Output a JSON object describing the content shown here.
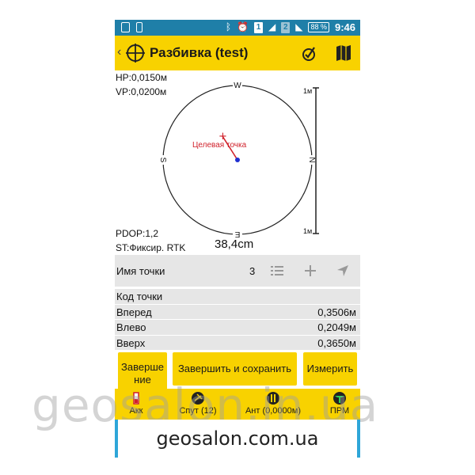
{
  "status_bar": {
    "battery": "88 %",
    "time": "9:46",
    "sim1": "1",
    "sim2": "2"
  },
  "toolbar": {
    "title": "Разбивка (test)",
    "icons": [
      "back-chevron-icon",
      "stakeout-target-icon",
      "stakeout-mode-icon",
      "map-icon"
    ]
  },
  "compass": {
    "hp": "HP:0,0150м",
    "vp": "VP:0,0200м",
    "pdop": "PDOP:1,2",
    "st": "ST:Фиксир. RTK",
    "distance": "38,4cm",
    "target_label": "Целевая точка",
    "dir_top": "W",
    "dir_right": "N",
    "dir_bottom": "E",
    "dir_left": "S",
    "scale_top": "1м",
    "scale_bottom": "1м"
  },
  "point_row": {
    "label": "Имя точки",
    "value": "3"
  },
  "data_rows": [
    {
      "key": "Код точки",
      "value": ""
    },
    {
      "key": "Вперед",
      "value": "0,3506м"
    },
    {
      "key": "Влево",
      "value": "0,2049м"
    },
    {
      "key": "Вверх",
      "value": "0,3650м"
    }
  ],
  "buttons": {
    "finish_line1": "Заверше",
    "finish_line2": "ние",
    "finish_save": "Завершить и сохранить",
    "measure": "Измерить"
  },
  "bottom_bar": [
    {
      "label": "Акк",
      "icon": "accuracy-icon"
    },
    {
      "label": "Спут (12)",
      "icon": "satellite-icon"
    },
    {
      "label": "Ант (0,0000м)",
      "icon": "antenna-icon"
    },
    {
      "label": "ПРМ",
      "icon": "receiver-icon"
    }
  ],
  "watermark": {
    "big": "geosalon.in.ua",
    "footer": "geosalon.com.ua"
  },
  "colors": {
    "accent_yellow": "#f8d200",
    "status_blue": "#1f7fa8",
    "target_red": "#d0202a",
    "position_blue": "#1f2fd0"
  }
}
